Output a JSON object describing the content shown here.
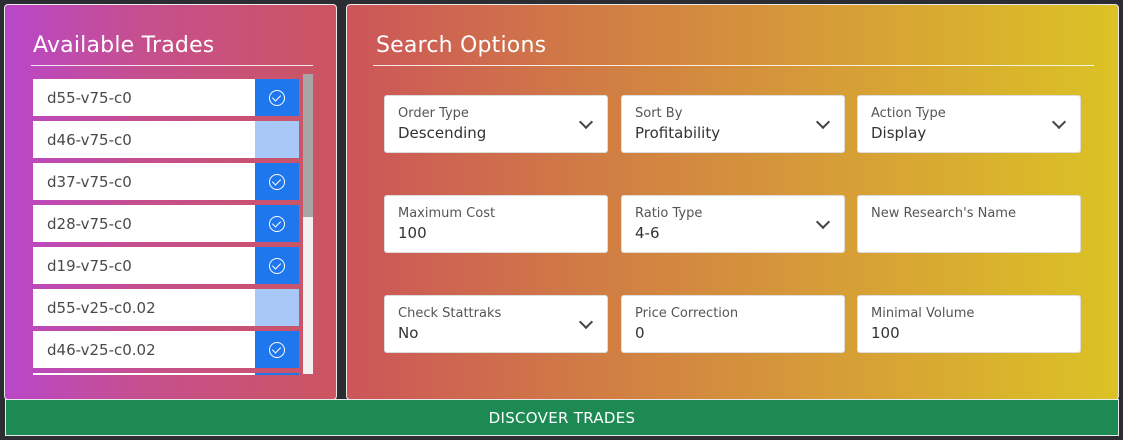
{
  "left_panel": {
    "title": "Available Trades",
    "trades": [
      {
        "name": "d55-v75-c0",
        "checked": true
      },
      {
        "name": "d46-v75-c0",
        "checked": false
      },
      {
        "name": "d37-v75-c0",
        "checked": true
      },
      {
        "name": "d28-v75-c0",
        "checked": true
      },
      {
        "name": "d19-v75-c0",
        "checked": true
      },
      {
        "name": "d55-v25-c0.02",
        "checked": false
      },
      {
        "name": "d46-v25-c0.02",
        "checked": true
      }
    ]
  },
  "right_panel": {
    "title": "Search Options",
    "fields": [
      {
        "label": "Order Type",
        "value": "Descending",
        "dropdown": true
      },
      {
        "label": "Sort By",
        "value": "Profitability",
        "dropdown": true
      },
      {
        "label": "Action Type",
        "value": "Display",
        "dropdown": true
      },
      {
        "label": "Maximum Cost",
        "value": "100",
        "dropdown": false
      },
      {
        "label": "Ratio Type",
        "value": "4-6",
        "dropdown": true
      },
      {
        "label": "New Research's Name",
        "value": "",
        "dropdown": false
      },
      {
        "label": "Check Stattraks",
        "value": "No",
        "dropdown": true
      },
      {
        "label": "Price Correction",
        "value": "0",
        "dropdown": false
      },
      {
        "label": "Minimal Volume",
        "value": "100",
        "dropdown": false
      }
    ]
  },
  "discover_button": {
    "label": "DISCOVER TRADES"
  },
  "colors": {
    "check_on": "#1f77ee",
    "check_off": "#a8c8f8",
    "discover_bg": "#1c8a52"
  }
}
